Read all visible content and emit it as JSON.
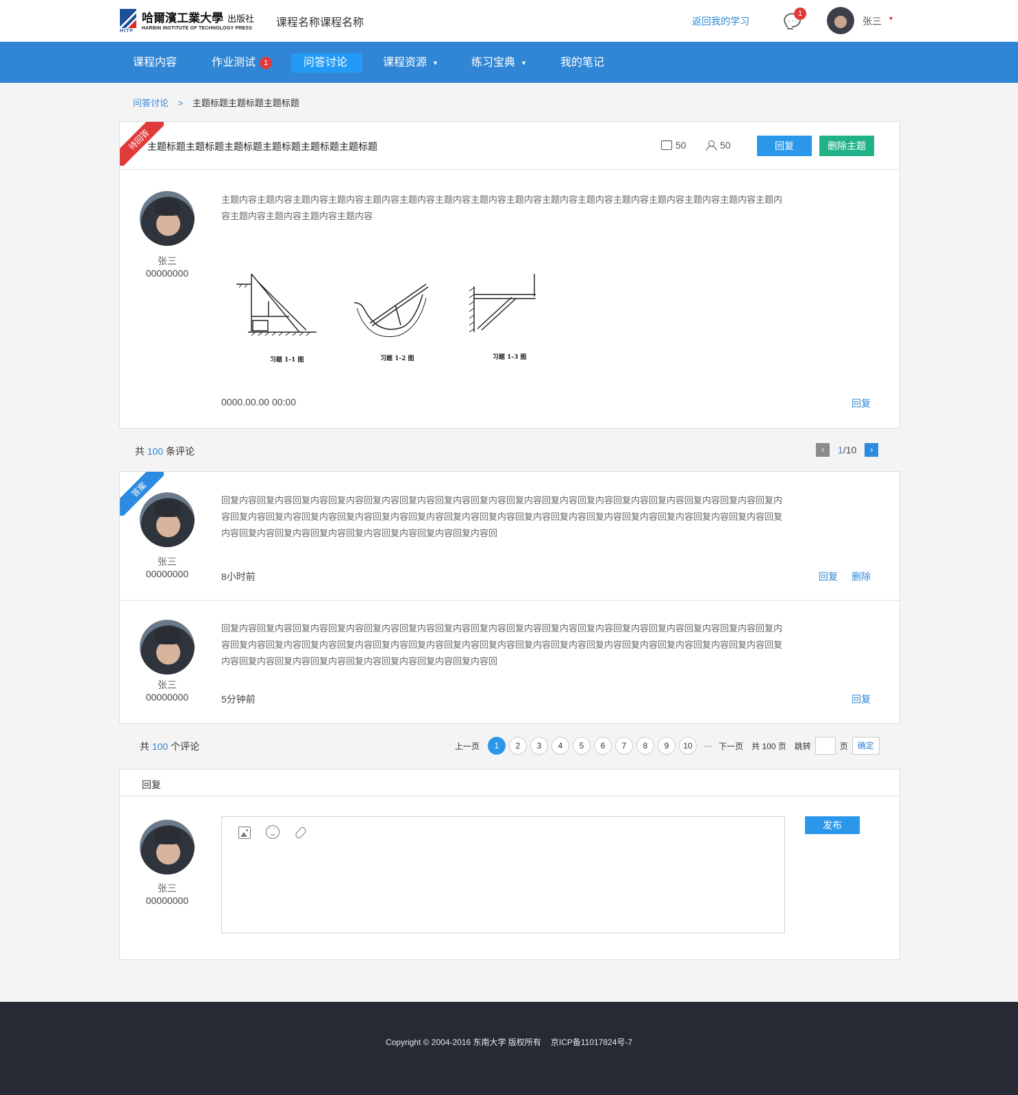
{
  "header": {
    "logo_cn": "哈爾濱工業大學",
    "logo_press": "出版社",
    "logo_en": "HARBIN INSTITUTE OF TECHNOLOGY PRESS",
    "logo_abbr": "HITP",
    "course_name": "课程名称课程名称",
    "back_link": "返回我的学习",
    "message_count": "1",
    "user_name": "张三",
    "caret": "▼"
  },
  "nav": {
    "items": [
      {
        "label": "课程内容"
      },
      {
        "label": "作业测试",
        "badge": "1"
      },
      {
        "label": "问答讨论"
      },
      {
        "label": "课程资源",
        "caret": "▼"
      },
      {
        "label": "练习宝典",
        "caret": "▼"
      },
      {
        "label": "我的笔记"
      }
    ]
  },
  "breadcrumb": {
    "parent": "问答讨论",
    "separator": ">",
    "current": "主题标题主题标题主题标题"
  },
  "topic": {
    "ribbon": "待回答",
    "title": "主题标题主题标题主题标题主题标题主题标题主题标题",
    "comments": "50",
    "views": "50",
    "reply_button": "回复",
    "delete_button": "删除主题",
    "author_name": "张三",
    "author_id": "00000000",
    "body": "主题内容主题内容主题内容主题内容主题内容主题内容主题内容主题内容主题内容主题内容主题内容主题内容主题内容主题内容主题内容主题内容主题内容主题内容主题内容主题内容",
    "figure_captions": [
      "习题 1-1 图",
      "习题 1-2 图",
      "习题 1-3 图"
    ],
    "timestamp": "0000.00.00 00:00",
    "reply_link": "回复"
  },
  "comments_summary": {
    "prefix": "共",
    "count": "100",
    "suffix": "条评论",
    "page_current": "1",
    "page_total": "/10",
    "prev_icon": "‹",
    "next_icon": "›"
  },
  "replies": [
    {
      "ribbon": "答案",
      "author_name": "张三",
      "author_id": "00000000",
      "text": "回复内容回复内容回复内容回复内容回复内容回复内容回复内容回复内容回复内容回复内容回复内容回复内容回复内容回复内容回复内容回复内容回复内容回复内容回复内容回复内容回复内容回复内容回复内容回复内容回复内容回复内容回复内容回复内容回复内容回复内容回复内容回复内容回复内容回复内容回复内容回复内容回复内容回复内容回复内容回",
      "time": "8小时前",
      "reply_link": "回复",
      "delete_link": "删除"
    },
    {
      "author_name": "张三",
      "author_id": "00000000",
      "text": "回复内容回复内容回复内容回复内容回复内容回复内容回复内容回复内容回复内容回复内容回复内容回复内容回复内容回复内容回复内容回复内容回复内容回复内容回复内容回复内容回复内容回复内容回复内容回复内容回复内容回复内容回复内容回复内容回复内容回复内容回复内容回复内容回复内容回复内容回复内容回复内容回复内容回复内容回复内容回",
      "time": "5分钟前",
      "reply_link": "回复"
    }
  ],
  "pagination": {
    "total_prefix": "共",
    "total_count": "100",
    "total_suffix": "个评论",
    "prev": "上一页",
    "pages": [
      "1",
      "2",
      "3",
      "4",
      "5",
      "6",
      "7",
      "8",
      "9",
      "10"
    ],
    "ellipsis": "···",
    "next": "下一页",
    "total_pages": "共 100 页",
    "jump_label": "跳转",
    "page_unit": "页",
    "confirm": "确定"
  },
  "reply_box": {
    "title": "回复",
    "author_name": "张三",
    "author_id": "00000000",
    "publish": "发布"
  },
  "footer": {
    "copyright": "Copyright © 2004-2016 东南大学 版权所有",
    "icp": "京ICP备11017824号-7"
  },
  "colors": {
    "nav_blue": "#3086d5",
    "link_blue": "#2d86d6",
    "badge_red": "#e03a3a",
    "delete_green": "#21b387",
    "footer_bg": "#272a35"
  }
}
